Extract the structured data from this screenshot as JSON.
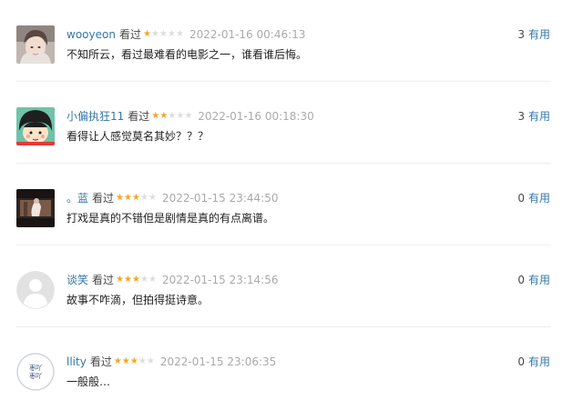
{
  "comments": [
    {
      "user": "wooyeon",
      "status": "看过",
      "rating": 1,
      "time": "2022-01-16 00:46:13",
      "useful_count": "3",
      "useful_label": "有用",
      "text": "不知所云，看过最难看的电影之一，谁看谁后悔。"
    },
    {
      "user": "小偏执狂11",
      "status": "看过",
      "rating": 2,
      "time": "2022-01-16 00:18:30",
      "useful_count": "3",
      "useful_label": "有用",
      "text": "看得让人感觉莫名其妙？？？"
    },
    {
      "user": "。蓝",
      "status": "看过",
      "rating": 3,
      "time": "2022-01-15 23:44:50",
      "useful_count": "0",
      "useful_label": "有用",
      "text": "打戏是真的不错但是剧情是真的有点离谱。"
    },
    {
      "user": "谈笑",
      "status": "看过",
      "rating": 3,
      "time": "2022-01-15 23:14:56",
      "useful_count": "0",
      "useful_label": "有用",
      "text": "故事不咋滴，但拍得挺诗意。"
    },
    {
      "user": "llity",
      "status": "看过",
      "rating": 3,
      "time": "2022-01-15 23:06:35",
      "useful_count": "0",
      "useful_label": "有用",
      "text": "一般般…"
    }
  ],
  "avatar_5_text": [
    "枣吖",
    "枣吖"
  ],
  "colors": {
    "link": "#3377aa",
    "star_on": "#f5a623",
    "star_off": "#dddddd",
    "time": "#aaaaaa"
  }
}
